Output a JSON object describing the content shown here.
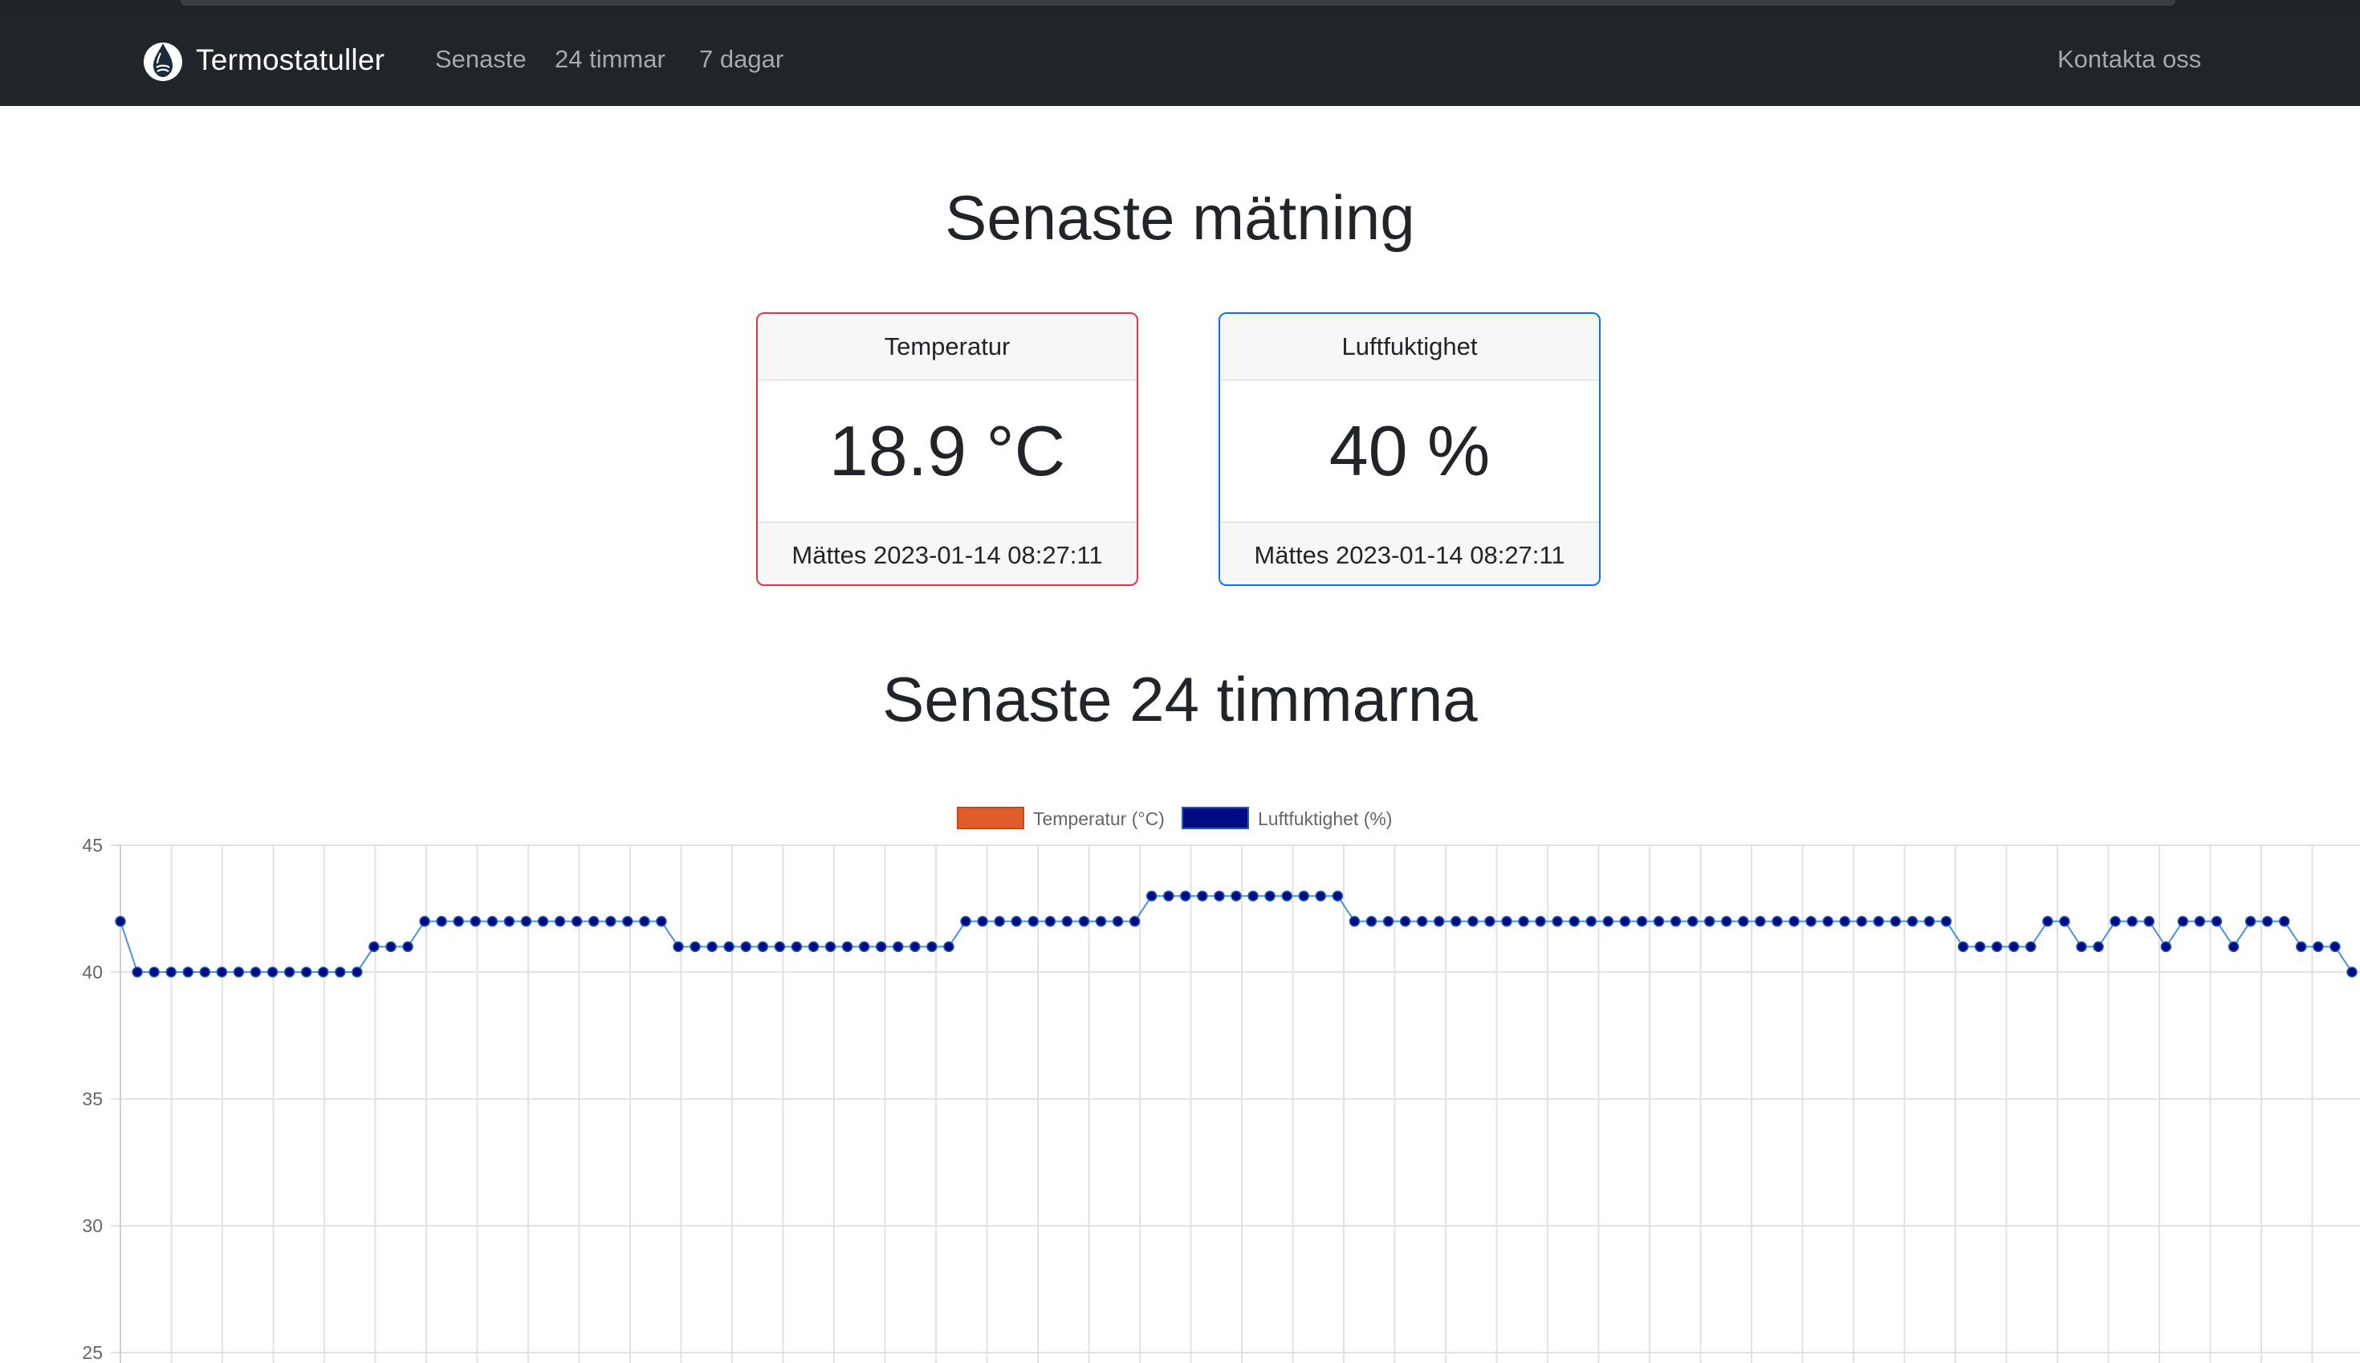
{
  "navbar": {
    "brand": "Termostatuller",
    "links": [
      "Senaste",
      "24 timmar",
      "7 dagar"
    ],
    "contact": "Kontakta oss"
  },
  "latest": {
    "heading": "Senaste mätning",
    "temperature": {
      "header": "Temperatur",
      "value": "18.9 °C",
      "footer": "Mättes 2023-01-14 08:27:11",
      "border_color": "#dc3545"
    },
    "humidity": {
      "header": "Luftfuktighet",
      "value": "40 %",
      "footer": "Mättes 2023-01-14 08:27:11",
      "border_color": "#0d6efd"
    }
  },
  "last24": {
    "heading": "Senaste 24 timmarna"
  },
  "chart_data": {
    "type": "line",
    "legend_position": "top-center",
    "grid": true,
    "ylim": [
      25,
      45
    ],
    "yticks": [
      25,
      30,
      35,
      40,
      45
    ],
    "series": [
      {
        "name": "Temperatur (°C)",
        "color": "#e05d2a",
        "values": []
      },
      {
        "name": "Luftfuktighet (%)",
        "color": "#000a82",
        "line_color": "#4a90e2",
        "values": [
          42,
          40,
          40,
          40,
          40,
          40,
          40,
          40,
          40,
          40,
          40,
          40,
          40,
          40,
          40,
          41,
          41,
          41,
          42,
          42,
          42,
          42,
          42,
          42,
          42,
          42,
          42,
          42,
          42,
          42,
          42,
          42,
          42,
          41,
          41,
          41,
          41,
          41,
          41,
          41,
          41,
          41,
          41,
          41,
          41,
          41,
          41,
          41,
          41,
          41,
          42,
          42,
          42,
          42,
          42,
          42,
          42,
          42,
          42,
          42,
          42,
          43,
          43,
          43,
          43,
          43,
          43,
          43,
          43,
          43,
          43,
          43,
          43,
          42,
          42,
          42,
          42,
          42,
          42,
          42,
          42,
          42,
          42,
          42,
          42,
          42,
          42,
          42,
          42,
          42,
          42,
          42,
          42,
          42,
          42,
          42,
          42,
          42,
          42,
          42,
          42,
          42,
          42,
          42,
          42,
          42,
          42,
          42,
          42,
          41,
          41,
          41,
          41,
          41,
          42,
          42,
          41,
          41,
          42,
          42,
          42,
          41,
          42,
          42,
          42,
          41,
          42,
          42,
          42,
          41,
          41,
          41,
          40
        ]
      }
    ]
  }
}
